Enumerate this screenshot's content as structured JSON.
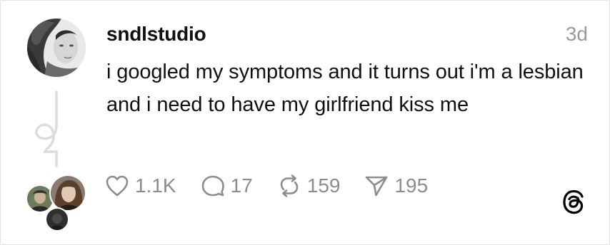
{
  "post": {
    "username": "sndlstudio",
    "time": "3d",
    "text": "i googled my symptoms and it turns out i'm a lesbian and i need to have my girlfriend kiss me"
  },
  "actions": {
    "likes": "1.1K",
    "replies": "17",
    "reposts": "159",
    "shares": "195"
  },
  "icons": {
    "like": "heart-icon",
    "reply": "comment-icon",
    "repost": "repost-icon",
    "share": "send-icon",
    "brand": "threads-logo-icon"
  },
  "colors": {
    "text": "#101010",
    "muted": "#8c8c8c",
    "line": "#dcdcdc"
  }
}
